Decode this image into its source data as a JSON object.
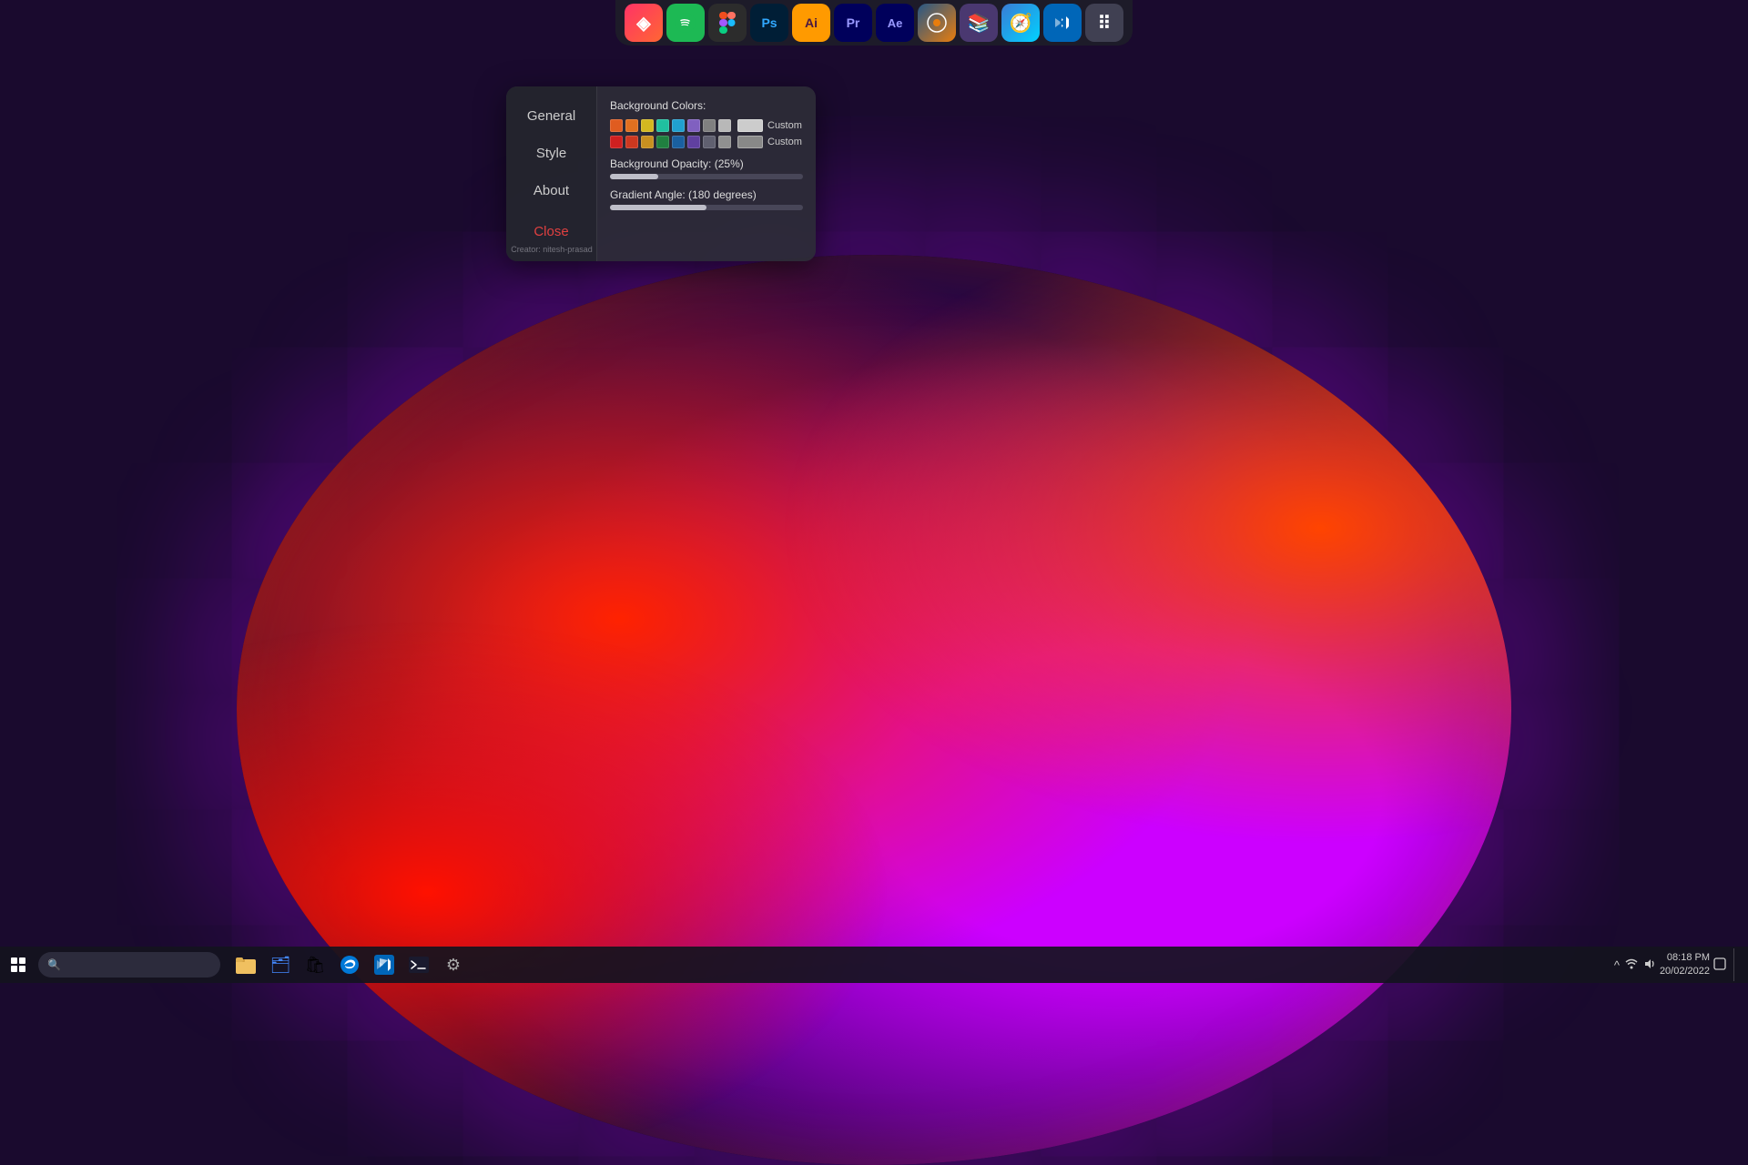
{
  "background": {
    "color": "#1a0a2e"
  },
  "top_taskbar": {
    "icons": [
      {
        "id": "linearity",
        "label": "Linearity",
        "class": "icon-linearity",
        "glyph": "◈"
      },
      {
        "id": "spotify",
        "label": "Spotify",
        "class": "icon-spotify",
        "glyph": "♫"
      },
      {
        "id": "figma",
        "label": "Figma",
        "class": "icon-figma",
        "glyph": "✦"
      },
      {
        "id": "photoshop",
        "label": "Photoshop",
        "class": "icon-ps",
        "glyph": "Ps"
      },
      {
        "id": "illustrator",
        "label": "Illustrator",
        "class": "icon-ai",
        "glyph": "Ai"
      },
      {
        "id": "premiere",
        "label": "Premiere Pro",
        "class": "icon-pr",
        "glyph": "Pr"
      },
      {
        "id": "aftereffects",
        "label": "After Effects",
        "class": "icon-ae",
        "glyph": "Ae"
      },
      {
        "id": "blender",
        "label": "Blender",
        "class": "icon-blender",
        "glyph": "⬡"
      },
      {
        "id": "books",
        "label": "Books",
        "class": "icon-books",
        "glyph": "📚"
      },
      {
        "id": "compass",
        "label": "Compass",
        "class": "icon-compass",
        "glyph": "🧭"
      },
      {
        "id": "vscode",
        "label": "VS Code",
        "class": "icon-vscode",
        "glyph": "⌥"
      },
      {
        "id": "menu",
        "label": "Menu",
        "class": "icon-menu",
        "glyph": "⠿"
      }
    ]
  },
  "settings_dialog": {
    "nav_items": [
      {
        "id": "general",
        "label": "General",
        "active": false
      },
      {
        "id": "style",
        "label": "Style",
        "active": true
      },
      {
        "id": "about",
        "label": "About",
        "active": false
      },
      {
        "id": "close",
        "label": "Close",
        "is_close": true
      }
    ],
    "creator_text": "Creator: nitesh-prasad",
    "content": {
      "background_colors_label": "Background Colors:",
      "color_row1": [
        {
          "color": "#e05c20"
        },
        {
          "color": "#e07020"
        },
        {
          "color": "#d4b820"
        },
        {
          "color": "#20c0a0"
        },
        {
          "color": "#20a0d0"
        },
        {
          "color": "#8060c0"
        },
        {
          "color": "#808080"
        },
        {
          "color": "#b0b0b0"
        }
      ],
      "color_row2": [
        {
          "color": "#d02020"
        },
        {
          "color": "#cc3820"
        },
        {
          "color": "#c89020"
        },
        {
          "color": "#208040"
        },
        {
          "color": "#1a60a0"
        },
        {
          "color": "#6040a0"
        },
        {
          "color": "#606070"
        },
        {
          "color": "#909090"
        }
      ],
      "custom_box1_color": "#cccccc",
      "custom_box2_color": "#888888",
      "custom_label": "Custom",
      "opacity_label": "Background Opacity: (25%)",
      "opacity_value": 25,
      "angle_label": "Gradient Angle: (180 degrees)",
      "angle_value": 50
    }
  },
  "bottom_taskbar": {
    "icons": [
      {
        "id": "explorer",
        "label": "File Explorer",
        "glyph": "📁",
        "color": "#f0c060"
      },
      {
        "id": "edge_file",
        "label": "File Manager",
        "glyph": "🗂",
        "color": "#4488ff"
      },
      {
        "id": "store",
        "label": "Microsoft Store",
        "glyph": "🛍",
        "color": "#00aaff"
      },
      {
        "id": "edge",
        "label": "Edge",
        "glyph": "🌐",
        "color": "#0078d7"
      },
      {
        "id": "vscode_bar",
        "label": "VS Code",
        "glyph": "⌥",
        "color": "#0066b8"
      },
      {
        "id": "terminal",
        "label": "Terminal",
        "glyph": "⬛",
        "color": "#333333"
      },
      {
        "id": "settings_bottom",
        "label": "Settings",
        "glyph": "⚙",
        "color": "#888888"
      }
    ],
    "system_tray": {
      "chevron": "^",
      "network": "🌐",
      "volume": "🔊",
      "time": "08:18 PM",
      "date": "20/02/2022"
    }
  }
}
